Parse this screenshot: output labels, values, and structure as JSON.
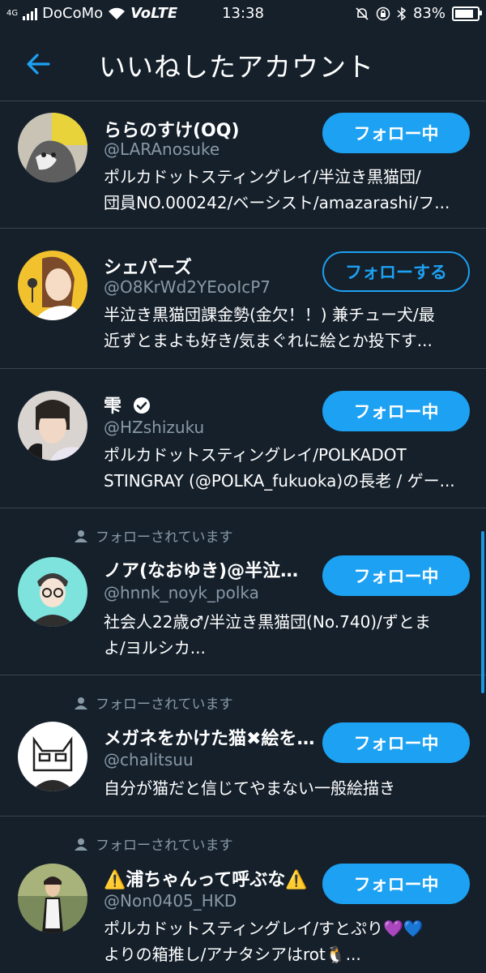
{
  "status_bar": {
    "network": "4G",
    "carrier": "DoCoMo",
    "volte": "VoLTE",
    "time": "13:38",
    "battery": "83%",
    "battery_level": 0.83
  },
  "header": {
    "title": "いいねしたアカウント"
  },
  "follows_you_label": "フォローされています",
  "accounts": [
    {
      "name": "ららのすけ(OQ)",
      "handle": "@LARAnosuke",
      "bio_lines": [
        "ポルカドットスティングレイ/半泣き黒猫団/",
        "団員NO.000242/ベーシスト/amazarashi/フ..."
      ],
      "button": "フォロー中",
      "verified": false,
      "follows_you": false
    },
    {
      "name": "シェパーズ",
      "handle": "@O8KrWd2YEooIcP7",
      "bio_lines": [
        "半泣き黒猫団課金勢(金欠！！) 兼チュー犬/最",
        "近ずとまよも好き/気まぐれに絵とか投下す..."
      ],
      "button": "フォローする",
      "verified": false,
      "follows_you": false
    },
    {
      "name": "雫",
      "handle": "@HZshizuku",
      "bio_lines": [
        "ポルカドットスティングレイ/POLKADOT",
        "STINGRAY (@POLKA_fukuoka)の長老 / ゲー..."
      ],
      "button": "フォロー中",
      "verified": true,
      "follows_you": false
    },
    {
      "name": "ノア(なおゆき)@半泣き...",
      "handle": "@hnnk_noyk_polka",
      "bio_lines": [
        "社会人22歳♂/半泣き黒猫団(No.740)/ずとま",
        "よ/ヨルシカ..."
      ],
      "button": "フォロー中",
      "verified": false,
      "follows_you": true
    },
    {
      "name": "メガネをかけた猫✖絵を...",
      "handle": "@chalitsuu",
      "bio_lines": [
        "自分が猫だと信じてやまない一般絵描き"
      ],
      "button": "フォロー中",
      "verified": false,
      "follows_you": true
    },
    {
      "name": "⚠️浦ちゃんって呼ぶな⚠️",
      "handle": "@Non0405_HKD",
      "bio_lines": [
        "ポルカドットスティングレイ/すとぷり💜💙",
        "よりの箱推し/アナタシアはrot🐧..."
      ],
      "button": "フォロー中",
      "verified": false,
      "follows_you": true
    }
  ],
  "colors": {
    "background": "#15202b",
    "accent": "#1da1f2",
    "secondary_text": "#8899a6",
    "divider": "#38444d"
  }
}
